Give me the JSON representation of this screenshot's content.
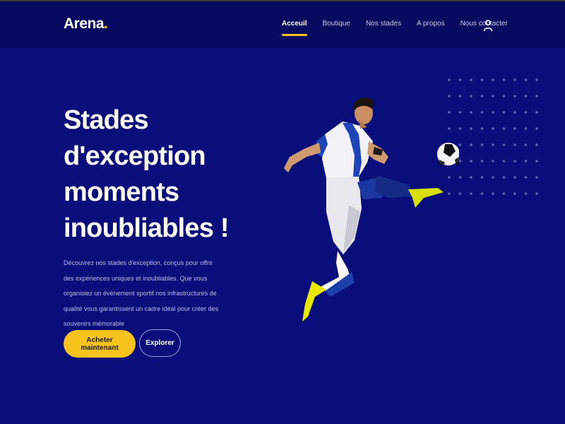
{
  "header": {
    "logo_text": "Arena",
    "logo_dot": ".",
    "nav": [
      {
        "label": "Acceuil",
        "active": true
      },
      {
        "label": "Boutique",
        "active": false
      },
      {
        "label": "Nos stades",
        "active": false
      },
      {
        "label": "A propos",
        "active": false
      },
      {
        "label": "Nous contacter",
        "active": false
      }
    ],
    "user_icon": "user-icon"
  },
  "hero": {
    "title_lines": [
      "Stades",
      "d'exception",
      "moments",
      "inoubliables !"
    ],
    "description": "Découvrez nos stades d'exception, conçus pour offrir des expériences uniques et inoubliables. Que vous organisiez un événement sportif nos infrastructures de qualité vous garantissent un cadre idéal pour créer des souvenirs mémorable",
    "primary_button": "Acheter maintenant",
    "secondary_button": "Explorer"
  },
  "colors": {
    "background": "#0a0e7a",
    "header_bg": "#080a5f",
    "accent": "#f6c21c",
    "text": "#ffffff"
  }
}
